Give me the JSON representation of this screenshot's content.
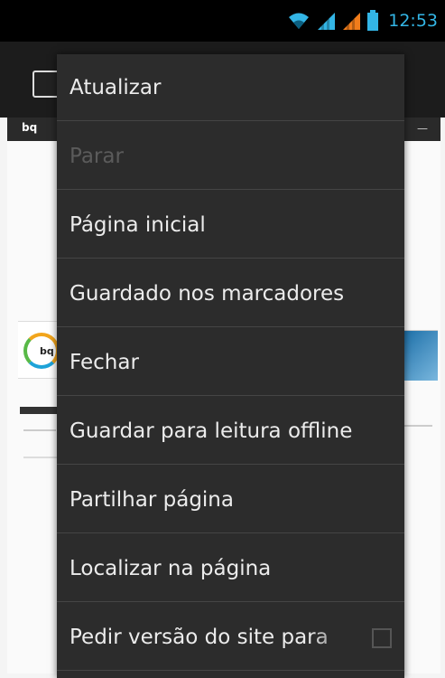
{
  "status_bar": {
    "time": "12:53",
    "icons": [
      "wifi-icon",
      "signal-icon",
      "signal-icon",
      "battery-icon"
    ],
    "accent_color": "#33b5e5",
    "secondary_signal_color": "#f07c1b"
  },
  "browser": {
    "tab_label": "bq",
    "tab_arrow": "—"
  },
  "menu": {
    "items": [
      {
        "label": "Atualizar",
        "enabled": true
      },
      {
        "label": "Parar",
        "enabled": false
      },
      {
        "label": "Página inicial",
        "enabled": true
      },
      {
        "label": "Guardado nos marcadores",
        "enabled": true
      },
      {
        "label": "Fechar",
        "enabled": true
      },
      {
        "label": "Guardar para leitura offline",
        "enabled": true
      },
      {
        "label": "Partilhar página",
        "enabled": true
      },
      {
        "label": "Localizar na página",
        "enabled": true
      },
      {
        "label": "Pedir versão do site para",
        "enabled": true,
        "checkbox": false
      }
    ]
  },
  "background_page": {
    "logo_text": "bq"
  }
}
